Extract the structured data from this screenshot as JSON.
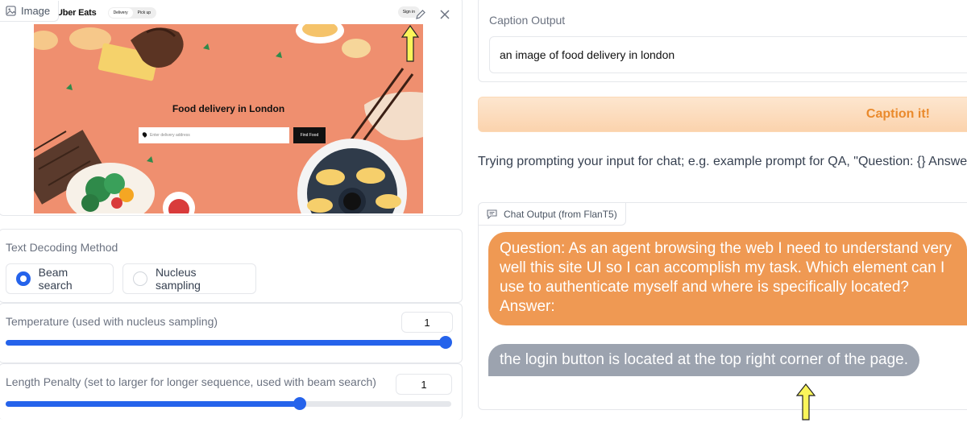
{
  "image_panel": {
    "label": "Image",
    "edit_icon": "pencil-icon",
    "close_icon": "close-icon",
    "preview": {
      "logo": "Uber Eats",
      "toggle": [
        "Delivery",
        "Pick up"
      ],
      "sign_in": "Sign in",
      "hero_title": "Food delivery in London",
      "address_placeholder": "Enter delivery address",
      "find_button": "Find Food"
    }
  },
  "decoding": {
    "title": "Text Decoding Method",
    "options": [
      {
        "label": "Beam search",
        "selected": true
      },
      {
        "label": "Nucleus sampling",
        "selected": false
      }
    ]
  },
  "temperature": {
    "label": "Temperature (used with nucleus sampling)",
    "value": "1",
    "fraction": 1.0
  },
  "length_penalty": {
    "label": "Length Penalty (set to larger for longer sequence, used with beam search)",
    "value": "1",
    "fraction": 0.66
  },
  "caption": {
    "title": "Caption Output",
    "value": "an image of food delivery in london",
    "button": "Caption it!"
  },
  "hint": "Trying prompting your input for chat; e.g. example prompt for QA, \"Question: {} Answer:\"",
  "chat": {
    "label": "Chat Output (from FlanT5)",
    "icon": "chat-icon",
    "user_message": "Question: As an agent browsing the web I need to understand very well this site UI so I can accomplish my task. Which element can I use to authenticate myself and where is specifically located? Answer:",
    "bot_message": "the login button is located at the top right corner of the page."
  },
  "colors": {
    "accent": "#2563eb",
    "user_bubble": "#ef9953",
    "bot_bubble": "#9ca3af",
    "caption_button_text": "#ea8a2c",
    "hero_bg": "#ef8f6f",
    "arrow": "#fbf55a"
  }
}
